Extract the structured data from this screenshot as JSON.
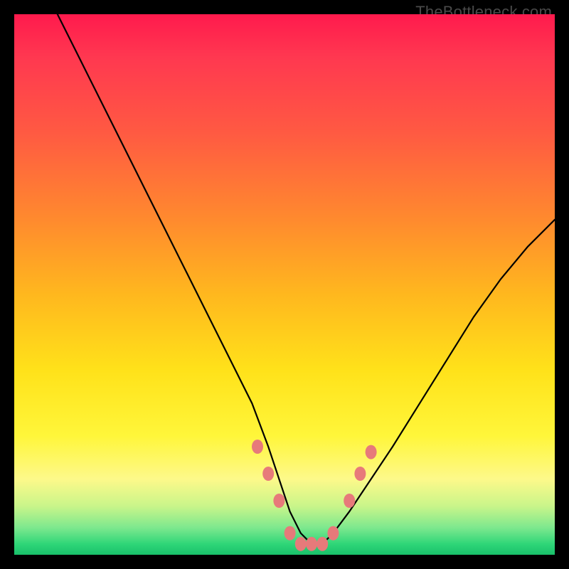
{
  "watermark": "TheBottleneck.com",
  "chart_data": {
    "type": "line",
    "title": "",
    "xlabel": "",
    "ylabel": "",
    "xlim": [
      0,
      100
    ],
    "ylim": [
      0,
      100
    ],
    "grid": false,
    "series": [
      {
        "name": "bottleneck-curve",
        "x": [
          8,
          12,
          16,
          20,
          24,
          28,
          32,
          36,
          40,
          44,
          47,
          49,
          51,
          53,
          55,
          57,
          59,
          62,
          66,
          70,
          75,
          80,
          85,
          90,
          95,
          100
        ],
        "y": [
          100,
          92,
          84,
          76,
          68,
          60,
          52,
          44,
          36,
          28,
          20,
          14,
          8,
          4,
          2,
          2,
          4,
          8,
          14,
          20,
          28,
          36,
          44,
          51,
          57,
          62
        ]
      }
    ],
    "markers": [
      {
        "name": "left-marker-1",
        "x": 45,
        "y": 20
      },
      {
        "name": "left-marker-2",
        "x": 47,
        "y": 15
      },
      {
        "name": "left-marker-3",
        "x": 49,
        "y": 10
      },
      {
        "name": "bottom-1",
        "x": 51,
        "y": 4
      },
      {
        "name": "bottom-2",
        "x": 53,
        "y": 2
      },
      {
        "name": "bottom-3",
        "x": 55,
        "y": 2
      },
      {
        "name": "bottom-4",
        "x": 57,
        "y": 2
      },
      {
        "name": "bottom-5",
        "x": 59,
        "y": 4
      },
      {
        "name": "right-marker-1",
        "x": 62,
        "y": 10
      },
      {
        "name": "right-marker-2",
        "x": 64,
        "y": 15
      },
      {
        "name": "right-marker-3",
        "x": 66,
        "y": 19
      }
    ],
    "gradient_stops": [
      {
        "pos": 0,
        "color": "#ff1a4d"
      },
      {
        "pos": 50,
        "color": "#ffd21e"
      },
      {
        "pos": 85,
        "color": "#fff76a"
      },
      {
        "pos": 100,
        "color": "#19c06a"
      }
    ]
  }
}
